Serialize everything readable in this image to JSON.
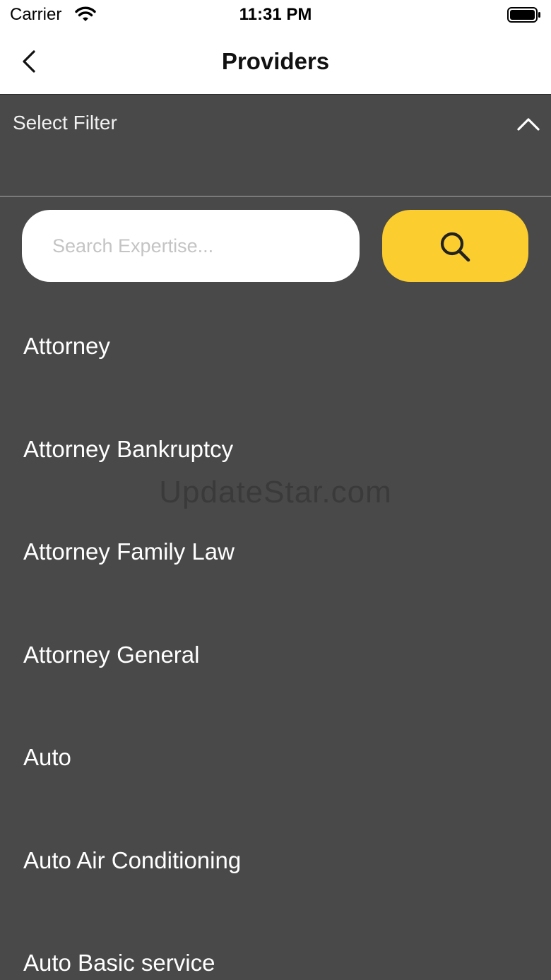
{
  "status_bar": {
    "carrier": "Carrier",
    "time": "11:31 PM"
  },
  "nav": {
    "title": "Providers"
  },
  "filter": {
    "label": "Select Filter"
  },
  "search": {
    "placeholder": "Search Expertise...",
    "value": "",
    "button_color": "#FBCD2E"
  },
  "expertise_list": [
    "Attorney",
    "Attorney Bankruptcy",
    "Attorney Family Law",
    "Attorney General",
    "Auto",
    "Auto Air Conditioning",
    "Auto Basic service"
  ],
  "watermark": "UpdateStar.com",
  "colors": {
    "background": "#494949",
    "accent": "#FBCD2E"
  }
}
